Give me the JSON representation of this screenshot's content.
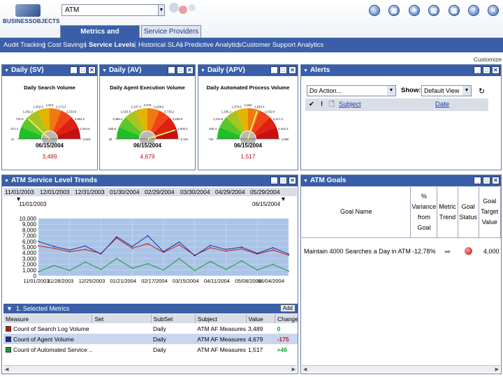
{
  "header": {
    "logo_text": "BUSINESSOBJECTS",
    "search_value": "ATM",
    "tabs": [
      "Metrics and Forecasting",
      "Service Providers"
    ],
    "toolbar_icons": [
      "home-icon",
      "save-icon",
      "settings-icon",
      "document-icon",
      "calendar-icon",
      "help-icon",
      "close-icon"
    ]
  },
  "nav": {
    "items": [
      "Audit Tracking",
      "Cost Savings",
      "Service Levels",
      "Historical SLAs",
      "Predictive Analytics",
      "Customer Support Analytics"
    ],
    "active": "Service Levels",
    "customize": "Customize"
  },
  "gauges": [
    {
      "panel_title": "Daily (SV)",
      "chart_title": "Daily Search Volume",
      "date": "06/15/2004",
      "value": "3,489",
      "needle_fraction": 0.24,
      "ticks": [
        "11",
        "371.4",
        "731.8",
        "1,092.2",
        "1,452.6",
        "1,813",
        "2,173.4",
        "2,533.8",
        "2,894.2",
        "3,254.6",
        "3,615"
      ]
    },
    {
      "panel_title": "Daily (AV)",
      "chart_title": "Daily Agent Execution Volume",
      "date": "06/15/2004",
      "value": "4,679",
      "needle_fraction": 0.9,
      "ticks": [
        "25",
        "555.6",
        "1,086.2",
        "1,616.8",
        "2,147.4",
        "2,678",
        "3,208.6",
        "3,739.2",
        "4,269.8",
        "4,800.4",
        "5,331"
      ]
    },
    {
      "panel_title": "Daily (APV)",
      "chart_title": "Daily Automated Process Volume",
      "date": "06/15/2004",
      "value": "1,517",
      "needle_fraction": 0.6,
      "ticks": [
        "742",
        "926.4",
        "1,110.8",
        "1,295.2",
        "1,479.6",
        "1,664",
        "1,848.4",
        "2,032.8",
        "2,217.2",
        "2,401.6",
        "2,586"
      ]
    }
  ],
  "alerts": {
    "title": "Alerts",
    "action_select": "Do Action...",
    "show_label": "Show:",
    "view_select": "Default View",
    "col_subject": "Subject",
    "col_date": "Date"
  },
  "trends": {
    "title": "ATM Service Level Trends",
    "date_strip": [
      "11/01/2003",
      "12/01/2003",
      "12/31/2003",
      "01/30/2004",
      "02/29/2004",
      "03/30/2004",
      "04/29/2004",
      "05/29/2004"
    ],
    "range_start": "11/01/2003",
    "range_end": "06/15/2004"
  },
  "chart_data": {
    "type": "line",
    "ylim": [
      0,
      10000
    ],
    "y_ticks": [
      "0",
      "1,000",
      "2,000",
      "3,000",
      "4,000",
      "5,000",
      "6,000",
      "7,000",
      "8,000",
      "9,000",
      "10,000"
    ],
    "x_ticks": [
      "11/01/2003",
      "11/28/2003",
      "12/25/2003",
      "01/21/2004",
      "02/17/2004",
      "03/15/2004",
      "04/11/2004",
      "05/08/2004",
      "06/04/2004"
    ],
    "x": [
      "11/01/2003",
      "11/15/2003",
      "11/29/2003",
      "12/13/2003",
      "12/27/2003",
      "01/10/2004",
      "01/24/2004",
      "02/07/2004",
      "02/21/2004",
      "03/06/2004",
      "03/20/2004",
      "04/03/2004",
      "04/17/2004",
      "05/01/2004",
      "05/15/2004",
      "05/29/2004",
      "06/12/2004"
    ],
    "grid": true,
    "series": [
      {
        "color": "#d01818",
        "values": [
          5200,
          4800,
          4200,
          4600,
          3900,
          6600,
          4800,
          5600,
          4100,
          5400,
          3600,
          4900,
          4300,
          4700,
          3800,
          4500,
          3600
        ]
      },
      {
        "color": "#1a2aa0",
        "values": [
          6000,
          5100,
          4500,
          5200,
          3800,
          6800,
          5100,
          7000,
          4200,
          5900,
          3500,
          5300,
          4600,
          5000,
          3900,
          4900,
          3800
        ]
      },
      {
        "color": "#1a9a30",
        "values": [
          700,
          1800,
          900,
          2400,
          1100,
          3000,
          1300,
          2100,
          1000,
          3000,
          900,
          2500,
          1100,
          2600,
          1000,
          2000,
          800
        ]
      }
    ]
  },
  "selected_metrics": {
    "title": "1. Selected Metrics",
    "add_label": "Add",
    "columns": [
      "Measure",
      "Set",
      "SubSet",
      "Subject",
      "Value",
      "Change"
    ],
    "rows": [
      {
        "swatch": "#c01818",
        "measure": "Count of Search Log Volume",
        "set": "",
        "subset": "Daily",
        "subject": "ATM AF Measures",
        "value": "3,489",
        "change": "0",
        "change_color": "#1a9a30"
      },
      {
        "swatch": "#1a2aa0",
        "measure": "Count of Agent Volume",
        "set": "",
        "subset": "Daily",
        "subject": "ATM AF Measures",
        "value": "4,679",
        "change": "-175",
        "change_color": "#d01818"
      },
      {
        "swatch": "#1a9a30",
        "measure": "Count of Automated Service ..",
        "set": "",
        "subset": "Daily",
        "subject": "ATM AF Measures",
        "value": "1,517",
        "change": "+46",
        "change_color": "#1a9a30"
      }
    ]
  },
  "goals": {
    "title": "ATM Goals",
    "columns": [
      "Goal Name",
      "% Variance from Goal",
      "Metric Trend",
      "Goal Status",
      "Goal Target Value"
    ],
    "rows": [
      {
        "name": "Maintain 4000 Searches a Day in ATM",
        "variance": "-12.78%",
        "trend_icon": "right-arrow-icon",
        "status_icon": "status-ball-icon",
        "target": "4,000"
      }
    ]
  }
}
